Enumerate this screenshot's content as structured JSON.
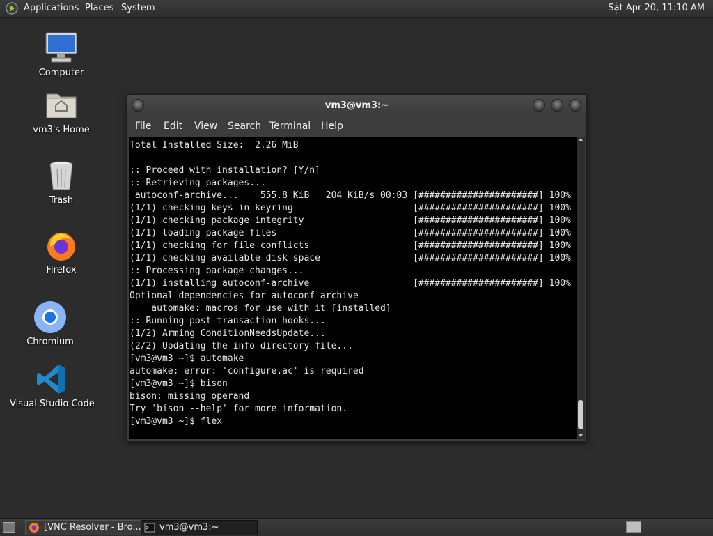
{
  "top_panel": {
    "menus": [
      "Applications",
      "Places",
      "System"
    ],
    "clock": "Sat Apr 20, 11:10 AM"
  },
  "desktop_icons": [
    {
      "label": "Computer",
      "icon": "computer-icon"
    },
    {
      "label": "vm3's Home",
      "icon": "home-folder-icon"
    },
    {
      "label": "Trash",
      "icon": "trash-icon"
    },
    {
      "label": "Firefox",
      "icon": "firefox-icon"
    },
    {
      "label": "Chromium",
      "icon": "chromium-icon"
    },
    {
      "label": "Visual Studio Code",
      "icon": "vscode-icon"
    }
  ],
  "terminal": {
    "title": "vm3@vm3:~",
    "menus": [
      "File",
      "Edit",
      "View",
      "Search",
      "Terminal",
      "Help"
    ],
    "lines": [
      "Total Installed Size:  2.26 MiB",
      "",
      ":: Proceed with installation? [Y/n]",
      ":: Retrieving packages...",
      " autoconf-archive...    555.8 KiB   204 KiB/s 00:03 [######################] 100%",
      "(1/1) checking keys in keyring                      [######################] 100%",
      "(1/1) checking package integrity                    [######################] 100%",
      "(1/1) loading package files                         [######################] 100%",
      "(1/1) checking for file conflicts                   [######################] 100%",
      "(1/1) checking available disk space                 [######################] 100%",
      ":: Processing package changes...",
      "(1/1) installing autoconf-archive                   [######################] 100%",
      "Optional dependencies for autoconf-archive",
      "    automake: macros for use with it [installed]",
      ":: Running post-transaction hooks...",
      "(1/2) Arming ConditionNeedsUpdate...",
      "(2/2) Updating the info directory file...",
      "[vm3@vm3 ~]$ automake",
      "automake: error: 'configure.ac' is required",
      "[vm3@vm3 ~]$ bison",
      "bison: missing operand",
      "Try 'bison --help' for more information.",
      "[vm3@vm3 ~]$ flex"
    ]
  },
  "taskbar": {
    "tasks": [
      {
        "label": "[VNC Resolver - Bro...",
        "icon": "firefox-icon",
        "active": false
      },
      {
        "label": "vm3@vm3:~",
        "icon": "terminal-icon",
        "active": true
      }
    ]
  }
}
